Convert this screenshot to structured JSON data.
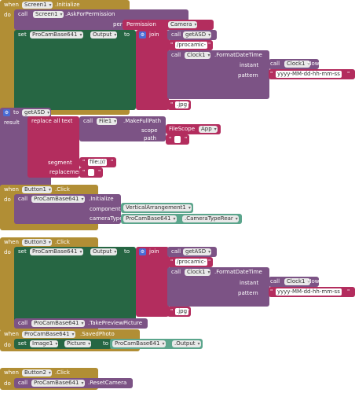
{
  "kw": {
    "when": "when",
    "do": "do",
    "call": "call",
    "set": "set",
    "to": "to",
    "join": "join",
    "result": "result",
    "replace_all_text": "replace all text",
    "quote": "\"",
    "gear": "⚙"
  },
  "b1": {
    "comp": "Screen1",
    "event": ".Initialize",
    "perm_comp": "Screen1",
    "perm_method": ".AskForPermission",
    "perm_name_label": "permissionName",
    "perm_prefix": "Permission",
    "perm_value": "Camera",
    "set_comp": "ProCamBase641",
    "set_prop": "Output",
    "proc_name": "getASD",
    "str1": "/procamic-",
    "clock": "Clock1",
    "format_method": ".FormatDateTime",
    "instant_label": "instant",
    "now_comp": "Clock1",
    "now_method": ".Now",
    "pattern_label": "pattern",
    "pattern": "yyyy-MM-dd-hh-mm-ss",
    "ext": ".jpg"
  },
  "b2": {
    "proc_def": "getASD",
    "file_comp": "File1",
    "file_method": ".MakeFullPath",
    "scope_label": "scope",
    "scope_prefix": "FileScope",
    "scope_value": "App",
    "path_label": "path",
    "segment_label": "segment",
    "segment": "file:///",
    "replacement_label": "replacement"
  },
  "b3": {
    "comp": "Button1",
    "event": ".Click",
    "init_comp": "ProCamBase641",
    "init_method": ".Initialize",
    "component_label": "component",
    "component": "VerticalArrangement1",
    "camera_label": "cameraType",
    "camera_comp": "ProCamBase641",
    "camera_value": ".CameraTypeRear"
  },
  "b4": {
    "comp": "Button3",
    "event": ".Click",
    "set_comp": "ProCamBase641",
    "set_prop": "Output",
    "proc_name": "getASD",
    "str1": "/procamic-",
    "clock": "Clock1",
    "format_method": ".FormatDateTime",
    "instant_label": "instant",
    "now_comp": "Clock1",
    "now_method": ".Now",
    "pattern_label": "pattern",
    "pattern": "yyyy-MM-dd-hh-mm-ss",
    "ext": ".jpg",
    "take_comp": "ProCamBase641",
    "take_method": ".TakePreviewPicture"
  },
  "b5": {
    "comp": "ProCamBase641",
    "event": ".SavedPhoto",
    "set_comp": "Image1",
    "set_prop": "Picture",
    "get_comp": "ProCamBase641",
    "get_prop": ".Output"
  },
  "b6": {
    "comp": "Button2",
    "event": ".Click",
    "call_comp": "ProCamBase641",
    "call_method": ".ResetCamera"
  }
}
